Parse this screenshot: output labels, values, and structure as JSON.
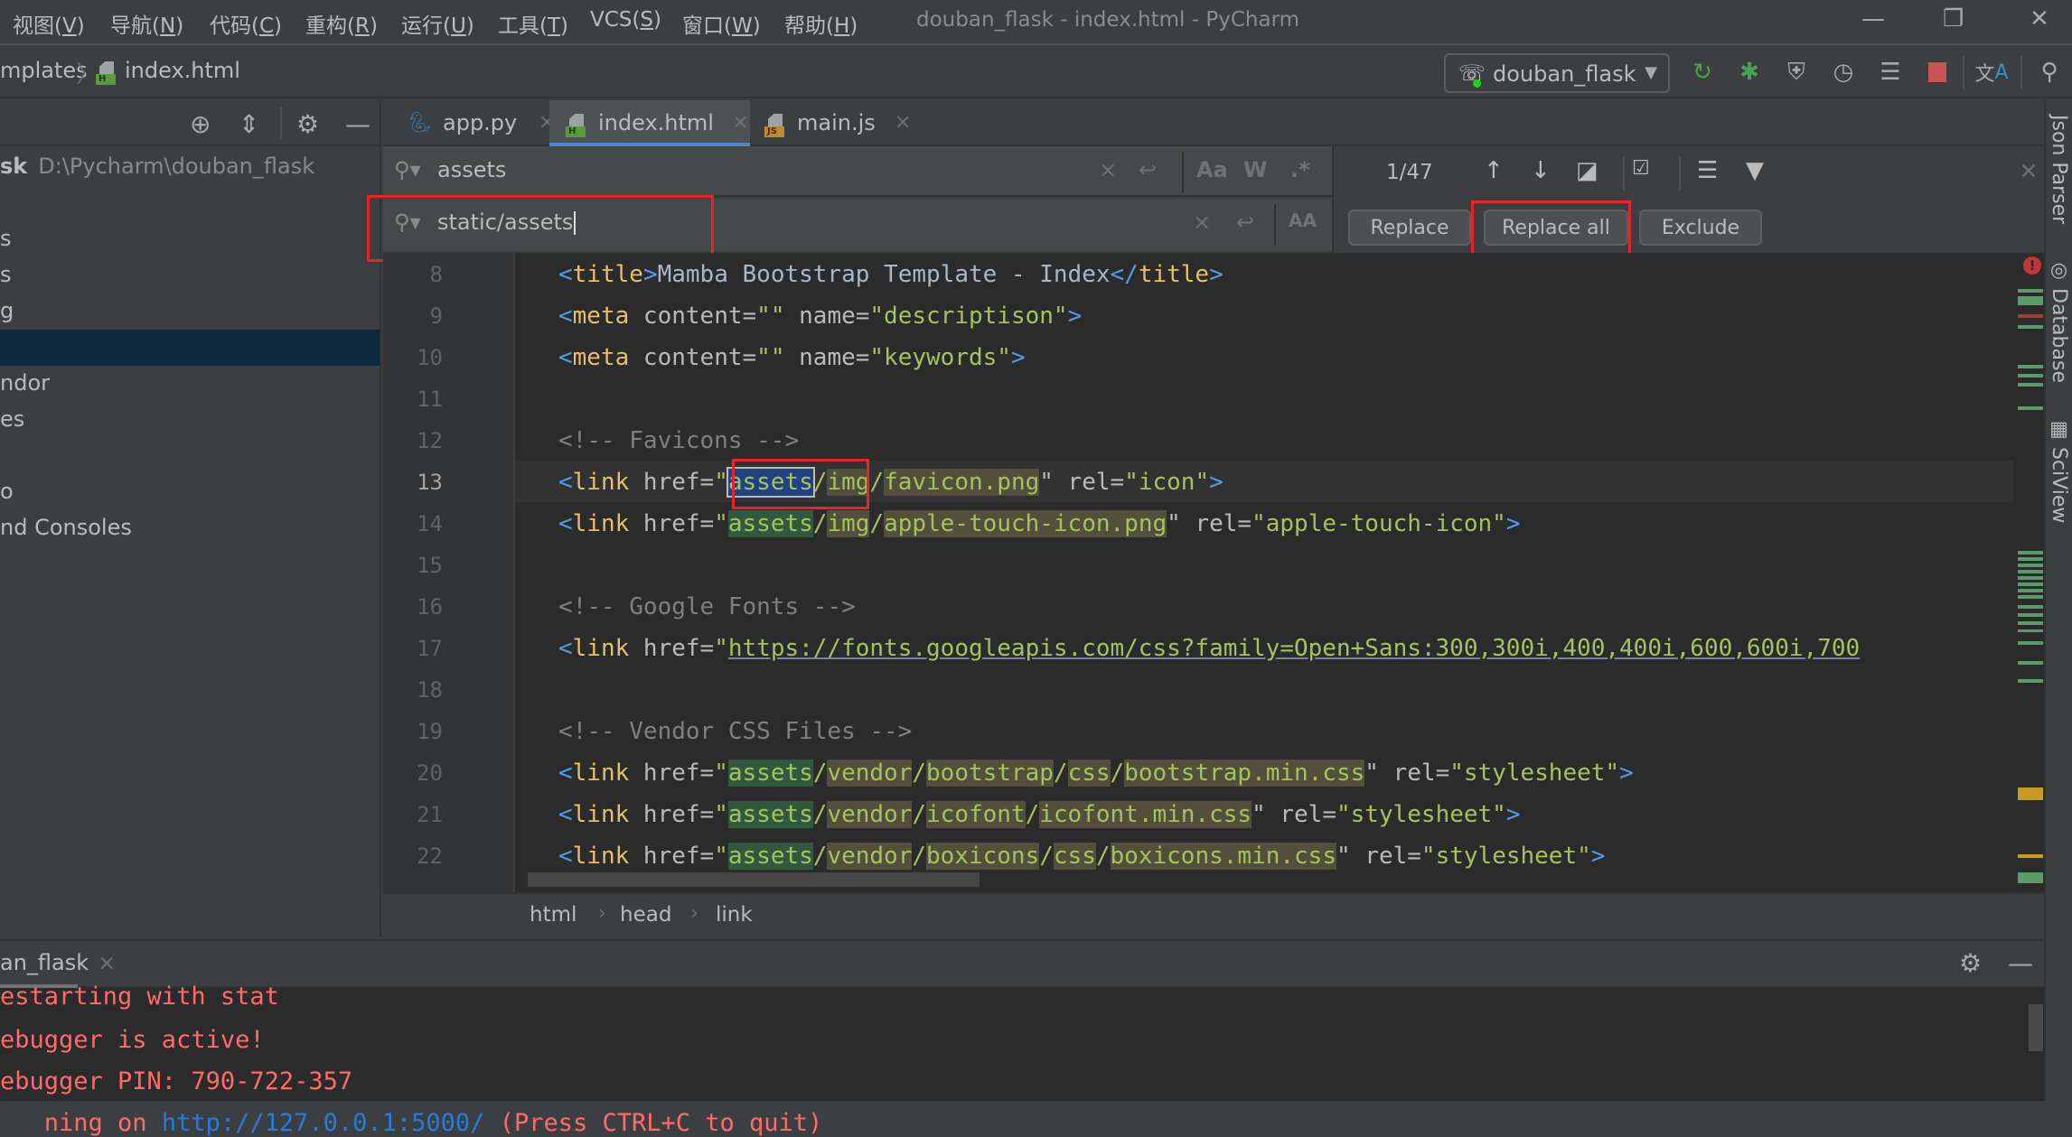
{
  "menu": {
    "items": [
      {
        "label": "视图(",
        "mnemonic": "V",
        "suffix": ")"
      },
      {
        "label": "导航(",
        "mnemonic": "N",
        "suffix": ")"
      },
      {
        "label": "代码(",
        "mnemonic": "C",
        "suffix": ")"
      },
      {
        "label": "重构(",
        "mnemonic": "R",
        "suffix": ")"
      },
      {
        "label": "运行(",
        "mnemonic": "U",
        "suffix": ")"
      },
      {
        "label": "工具(",
        "mnemonic": "T",
        "suffix": ")"
      },
      {
        "label": "VCS(",
        "mnemonic": "S",
        "suffix": ")"
      },
      {
        "label": "窗口(",
        "mnemonic": "W",
        "suffix": ")"
      },
      {
        "label": "帮助(",
        "mnemonic": "H",
        "suffix": ")"
      }
    ]
  },
  "window": {
    "title": "douban_flask - index.html - PyCharm",
    "minimize": "—",
    "restore": "❐",
    "close": "✕"
  },
  "navbar": {
    "crumbs": [
      "mplates",
      "index.html"
    ],
    "separator": "〉",
    "run_config": "douban_flask",
    "toolbar_icons": [
      "rerun-icon",
      "debug-icon",
      "coverage-icon",
      "profile-icon",
      "concurrency-icon",
      "stop-icon",
      "translate-icon",
      "search-everywhere-icon"
    ]
  },
  "project": {
    "header_icons": [
      "locate-icon",
      "collapse-all-icon",
      "settings-icon",
      "hide-icon"
    ],
    "root_name": "sk",
    "root_path": "D:\\Pycharm\\douban_flask",
    "rows": [
      "s",
      "s",
      "g",
      "",
      "ndor",
      "es",
      "",
      "o",
      "nd Consoles"
    ],
    "selected_index": 3
  },
  "tabs": [
    {
      "label": "app.py",
      "type": "py",
      "active": false
    },
    {
      "label": "index.html",
      "type": "html",
      "active": true
    },
    {
      "label": "main.js",
      "type": "js",
      "active": false
    }
  ],
  "find": {
    "search_value": "assets",
    "replace_value": "static/assets",
    "match_count": "1/47",
    "options": {
      "match_case": "Aa",
      "words": "W",
      "regex": ".*",
      "preserve_case": "AA"
    },
    "clear": "×",
    "newline": "↩",
    "buttons": {
      "replace": "Replace",
      "replace_all": "Replace all",
      "exclude": "Exclude"
    },
    "close": "×"
  },
  "editor": {
    "current_line": 13,
    "lines": [
      {
        "n": "8"
      },
      {
        "n": "9"
      },
      {
        "n": "10"
      },
      {
        "n": "11"
      },
      {
        "n": "12"
      },
      {
        "n": "13"
      },
      {
        "n": "14"
      },
      {
        "n": "15"
      },
      {
        "n": "16"
      },
      {
        "n": "17"
      },
      {
        "n": "18"
      },
      {
        "n": "19"
      },
      {
        "n": "20"
      },
      {
        "n": "21"
      },
      {
        "n": "22"
      }
    ],
    "code": {
      "l8": {
        "open": "<",
        "tag": "title",
        "close": ">",
        "text": "Mamba Bootstrap Template - Index",
        "end_open": "</",
        "end_tag": "title",
        "end_close": ">"
      },
      "l9": {
        "open": "<",
        "tag": "meta",
        "a1": " content=",
        "v1": "\"\"",
        "a2": " name=",
        "v2": "\"descriptison\"",
        "close": ">"
      },
      "l10": {
        "open": "<",
        "tag": "meta",
        "a1": " content=",
        "v1": "\"\"",
        "a2": " name=",
        "v2": "\"keywords\"",
        "close": ">"
      },
      "l12": {
        "comment": "<!-- Favicons -->"
      },
      "l13": {
        "open": "<",
        "tag": "link",
        "a1": " href=",
        "q": "\"",
        "hit": "assets",
        "s1": "/",
        "p1": "img",
        "s2": "/",
        "p2": "favicon.png",
        "q2": "\"",
        "a2": " rel=",
        "v2": "\"icon\"",
        "close": ">"
      },
      "l14": {
        "open": "<",
        "tag": "link",
        "a1": " href=",
        "q": "\"",
        "hit": "assets",
        "s1": "/",
        "p1": "img",
        "s2": "/",
        "p2": "apple-touch-icon.png",
        "q2": "\"",
        "a2": " rel=",
        "v2": "\"apple-touch-icon\"",
        "close": ">"
      },
      "l16": {
        "comment": "<!-- Google Fonts -->"
      },
      "l17": {
        "open": "<",
        "tag": "link",
        "a1": " href=",
        "q": "\"",
        "url": "https://fonts.googleapis.com/css?family=Open+Sans:300,300i,400,400i,600,600i,700"
      },
      "l19": {
        "comment": "<!-- Vendor CSS Files -->"
      },
      "l20": {
        "open": "<",
        "tag": "link",
        "a1": " href=",
        "q": "\"",
        "hit": "assets",
        "s1": "/",
        "p1": "vendor",
        "s2": "/",
        "p2": "bootstrap",
        "s3": "/",
        "p3": "css",
        "s4": "/",
        "p4": "bootstrap.min.css",
        "q2": "\"",
        "a2": " rel=",
        "v2": "\"stylesheet\"",
        "close": ">"
      },
      "l21": {
        "open": "<",
        "tag": "link",
        "a1": " href=",
        "q": "\"",
        "hit": "assets",
        "s1": "/",
        "p1": "vendor",
        "s2": "/",
        "p2": "icofont",
        "s3": "/",
        "p3": "icofont.min.css",
        "q2": "\"",
        "a2": " rel=",
        "v2": "\"stylesheet\"",
        "close": ">"
      },
      "l22": {
        "open": "<",
        "tag": "link",
        "a1": " href=",
        "q": "\"",
        "hit": "assets",
        "s1": "/",
        "p1": "vendor",
        "s2": "/",
        "p2": "boxicons",
        "s3": "/",
        "p3": "css",
        "s4": "/",
        "p4": "boxicons.min.css",
        "q2": "\"",
        "a2": " rel=",
        "v2": "\"stylesheet\"",
        "close": ">"
      }
    }
  },
  "breadcrumb": {
    "items": [
      "html",
      "head",
      "link"
    ],
    "separator": "›"
  },
  "right_strip": {
    "tools": [
      "Json Parser",
      "Database",
      "SciView"
    ]
  },
  "bottom": {
    "run_tab": "an_flask",
    "run_tab_close": "×",
    "console": [
      "estarting with stat",
      "ebugger is active!",
      "ebugger PIN: 790-722-357"
    ],
    "console_partial": {
      "prefix": "   ning on ",
      "link": "http://127.0.0.1:5000/",
      "suffix": " (Press CTRL+C to quit)"
    }
  }
}
